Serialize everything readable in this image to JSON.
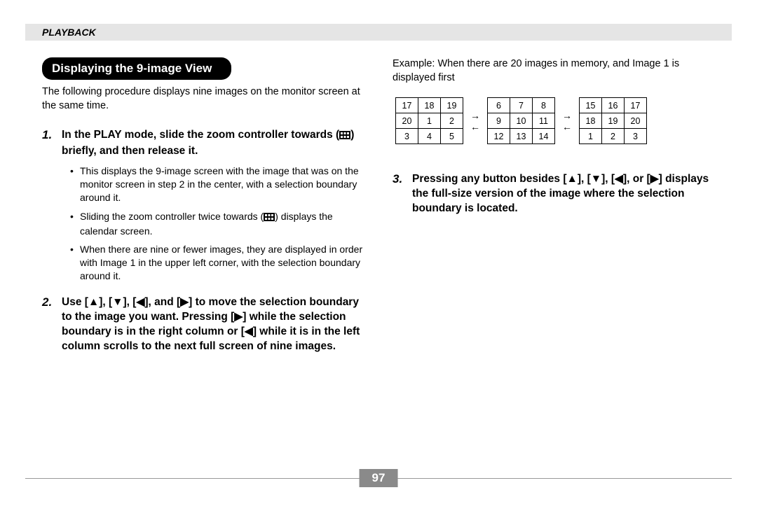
{
  "header": {
    "section": "PLAYBACK"
  },
  "title": "Displaying the 9-image View",
  "intro": "The following procedure displays nine images on the monitor screen at the same time.",
  "steps": {
    "s1": {
      "num": "1.",
      "text_a": "In the PLAY mode, slide the zoom controller towards (",
      "text_b": ") briefly, and then release it.",
      "bullets": [
        "This displays the 9-image screen with the image that was on the monitor screen in step 2 in the center, with a selection boundary around it.",
        "Sliding the zoom controller twice towards (  ) displays the calendar screen.",
        "When there are nine or fewer images, they are displayed in order with Image 1 in the upper left corner, with the selection boundary around it."
      ]
    },
    "s2": {
      "num": "2.",
      "text": "Use [▲], [▼], [◀], and [▶] to move the selection boundary to the image you want. Pressing [▶] while the selection boundary is in the right column or [◀] while it is in the left column scrolls to the next full screen of nine images."
    },
    "s3": {
      "num": "3.",
      "text": "Pressing any button besides [▲], [▼], [◀], or [▶] displays the full-size version of the image where the selection boundary is located."
    }
  },
  "example": {
    "label": "Example: When there are 20 images in memory, and Image 1 is displayed first",
    "grids": [
      [
        [
          "17",
          "18",
          "19"
        ],
        [
          "20",
          "1",
          "2"
        ],
        [
          "3",
          "4",
          "5"
        ]
      ],
      [
        [
          "6",
          "7",
          "8"
        ],
        [
          "9",
          "10",
          "11"
        ],
        [
          "12",
          "13",
          "14"
        ]
      ],
      [
        [
          "15",
          "16",
          "17"
        ],
        [
          "18",
          "19",
          "20"
        ],
        [
          "1",
          "2",
          "3"
        ]
      ]
    ]
  },
  "page_number": "97"
}
